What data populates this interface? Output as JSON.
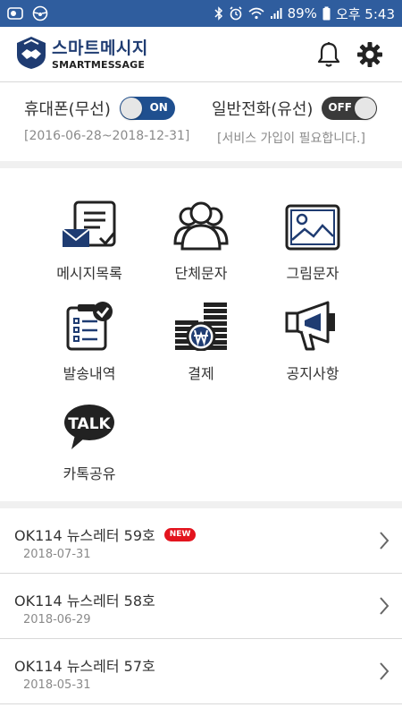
{
  "statusbar": {
    "battery": "89%",
    "time": "오후 5:43"
  },
  "header": {
    "logo_kr": "스마트메시지",
    "logo_en": "SMARTMESSAGE"
  },
  "toggles": [
    {
      "label": "휴대폰(무선)",
      "state": "ON",
      "sub": "[2016-06-28~2018-12-31]"
    },
    {
      "label": "일반전화(유선)",
      "state": "OFF",
      "sub": "[서비스 가입이 필요합니다.]"
    }
  ],
  "menu": [
    {
      "label": "메시지목록",
      "icon": "message-list-icon"
    },
    {
      "label": "단체문자",
      "icon": "group-icon"
    },
    {
      "label": "그림문자",
      "icon": "picture-icon"
    },
    {
      "label": "발송내역",
      "icon": "clipboard-check-icon"
    },
    {
      "label": "결제",
      "icon": "won-coin-icon"
    },
    {
      "label": "공지사항",
      "icon": "megaphone-icon"
    },
    {
      "label": "카톡공유",
      "icon": "talk-icon"
    }
  ],
  "talk_text": "TALK",
  "news": [
    {
      "title": "OK114 뉴스레터 59호",
      "badge": "NEW",
      "date": "2018-07-31"
    },
    {
      "title": "OK114 뉴스레터 58호",
      "badge": "",
      "date": "2018-06-29"
    },
    {
      "title": "OK114 뉴스레터 57호",
      "badge": "",
      "date": "2018-05-31"
    }
  ],
  "colors": {
    "statusbar": "#2f5d9e",
    "accent": "#1f4f8f",
    "badge": "#e3141e"
  }
}
